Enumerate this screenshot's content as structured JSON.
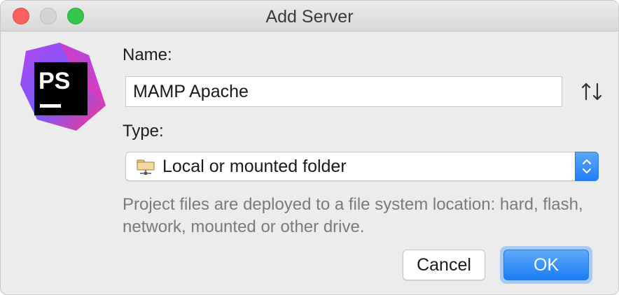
{
  "window": {
    "title": "Add Server"
  },
  "form": {
    "name_label": "Name:",
    "name_value": "MAMP Apache",
    "type_label": "Type:",
    "type_selected": "Local or mounted folder",
    "description": "Project files are deployed to a file system location: hard, flash, network, mounted or other drive."
  },
  "logo": {
    "text": "PS"
  },
  "buttons": {
    "cancel": "Cancel",
    "ok": "OK"
  },
  "icons": {
    "sort": "sort-arrows-icon",
    "folder": "network-folder-icon",
    "stepper": "chevron-up-down-icon"
  },
  "colors": {
    "accent": "#1c7cf5",
    "close": "#fc605c",
    "zoom": "#34c84a"
  }
}
